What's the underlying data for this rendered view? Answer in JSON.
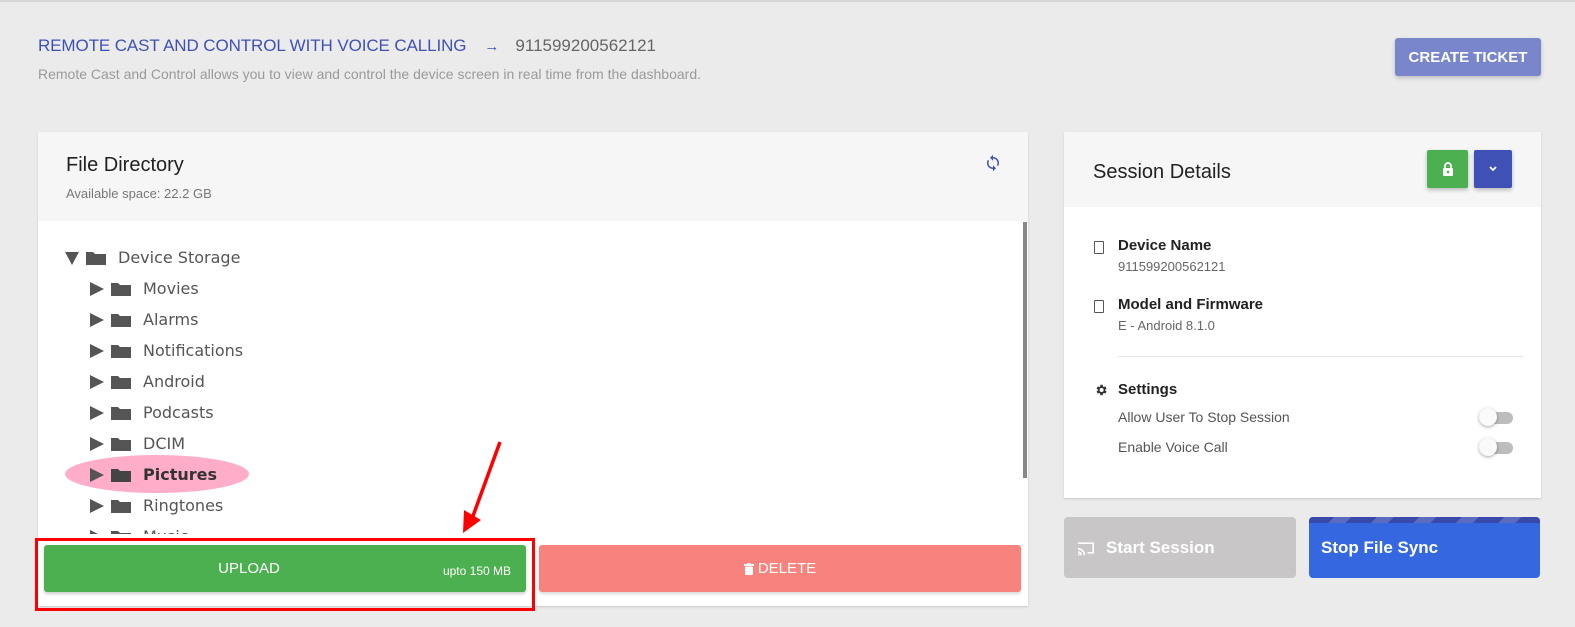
{
  "header": {
    "title": "REMOTE CAST AND CONTROL WITH VOICE CALLING",
    "arrow": "→",
    "device_id": "911599200562121",
    "subtitle": "Remote Cast and Control allows you to view and control the device screen in real time from the dashboard.",
    "create_ticket_label": "CREATE TICKET"
  },
  "file_directory": {
    "title": "File Directory",
    "available_space": "Available space: 22.2 GB",
    "root": {
      "label": "Device Storage",
      "expanded": true
    },
    "folders": [
      {
        "label": "Movies",
        "highlighted": false
      },
      {
        "label": "Alarms",
        "highlighted": false
      },
      {
        "label": "Notifications",
        "highlighted": false
      },
      {
        "label": "Android",
        "highlighted": false
      },
      {
        "label": "Podcasts",
        "highlighted": false
      },
      {
        "label": "DCIM",
        "highlighted": false
      },
      {
        "label": "Pictures",
        "highlighted": true
      },
      {
        "label": "Ringtones",
        "highlighted": false
      },
      {
        "label": "Music",
        "highlighted": false
      }
    ],
    "upload_label": "UPLOAD",
    "upload_limit": "upto 150 MB",
    "delete_label": "DELETE"
  },
  "session": {
    "title": "Session Details",
    "device_name_label": "Device Name",
    "device_name_value": "911599200562121",
    "model_label": "Model and Firmware",
    "model_value": "E - Android 8.1.0",
    "settings_label": "Settings",
    "settings": [
      {
        "label": "Allow User To Stop Session",
        "enabled": false
      },
      {
        "label": "Enable Voice Call",
        "enabled": false
      }
    ],
    "start_label": "Start Session",
    "stop_label": "Stop File Sync"
  },
  "colors": {
    "accent": "#3f51b5",
    "upload": "#4caf50",
    "delete": "#f8837d",
    "stop": "#3568e0",
    "highlight": "#ffadc8",
    "annotation": "#ff0000"
  }
}
